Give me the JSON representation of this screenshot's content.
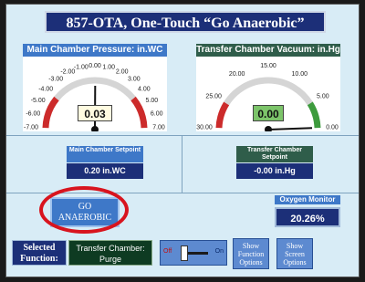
{
  "title": "857-OTA, One-Touch “Go Anaerobic”",
  "colors": {
    "navy": "#1c2f78",
    "screen_bg": "#d8ecf6",
    "pressure_header": "#3e78c8",
    "vacuum_header": "#2f5d4a",
    "ring_red": "#d8141e",
    "gauge_red": "#cc2b2b",
    "gauge_green": "#3d9b3d"
  },
  "main_gauge": {
    "header": "Main Chamber Pressure:  in.WC",
    "ticks": [
      "-7.00",
      "-6.00",
      "-5.00",
      "-4.00",
      "-3.00",
      "-2.00",
      "-1.00",
      "0.00",
      "1.00",
      "2.00",
      "3.00",
      "4.00",
      "5.00",
      "6.00",
      "7.00"
    ],
    "value": 0.03,
    "readout": "0.03",
    "range": [
      -7,
      7
    ]
  },
  "vacuum_gauge": {
    "header": "Transfer Chamber Vacuum: in.Hg",
    "ticks": [
      "30.00",
      "25.00",
      "20.00",
      "15.00",
      "10.00",
      "5.00",
      "0.00"
    ],
    "value": 0.0,
    "readout": "0.00",
    "range": [
      30,
      0
    ]
  },
  "main_setpoint": {
    "label": "Main Chamber Setpoint",
    "value": "0.20 in.WC"
  },
  "transfer_setpoint": {
    "label": "Transfer Chamber Setpoint",
    "value": "-0.00 in.Hg"
  },
  "go_button": {
    "label": "GO ANAEROBIC"
  },
  "oxygen": {
    "label": "Oxygen Monitor",
    "value": "20.26%"
  },
  "selected_function": {
    "label": "Selected Function:",
    "value": "Transfer Chamber: Purge"
  },
  "toggle": {
    "off": "Off",
    "on": "On",
    "state": "off"
  },
  "show_function_options": "Show Function Options",
  "show_screen_options": "Show Screen Options"
}
